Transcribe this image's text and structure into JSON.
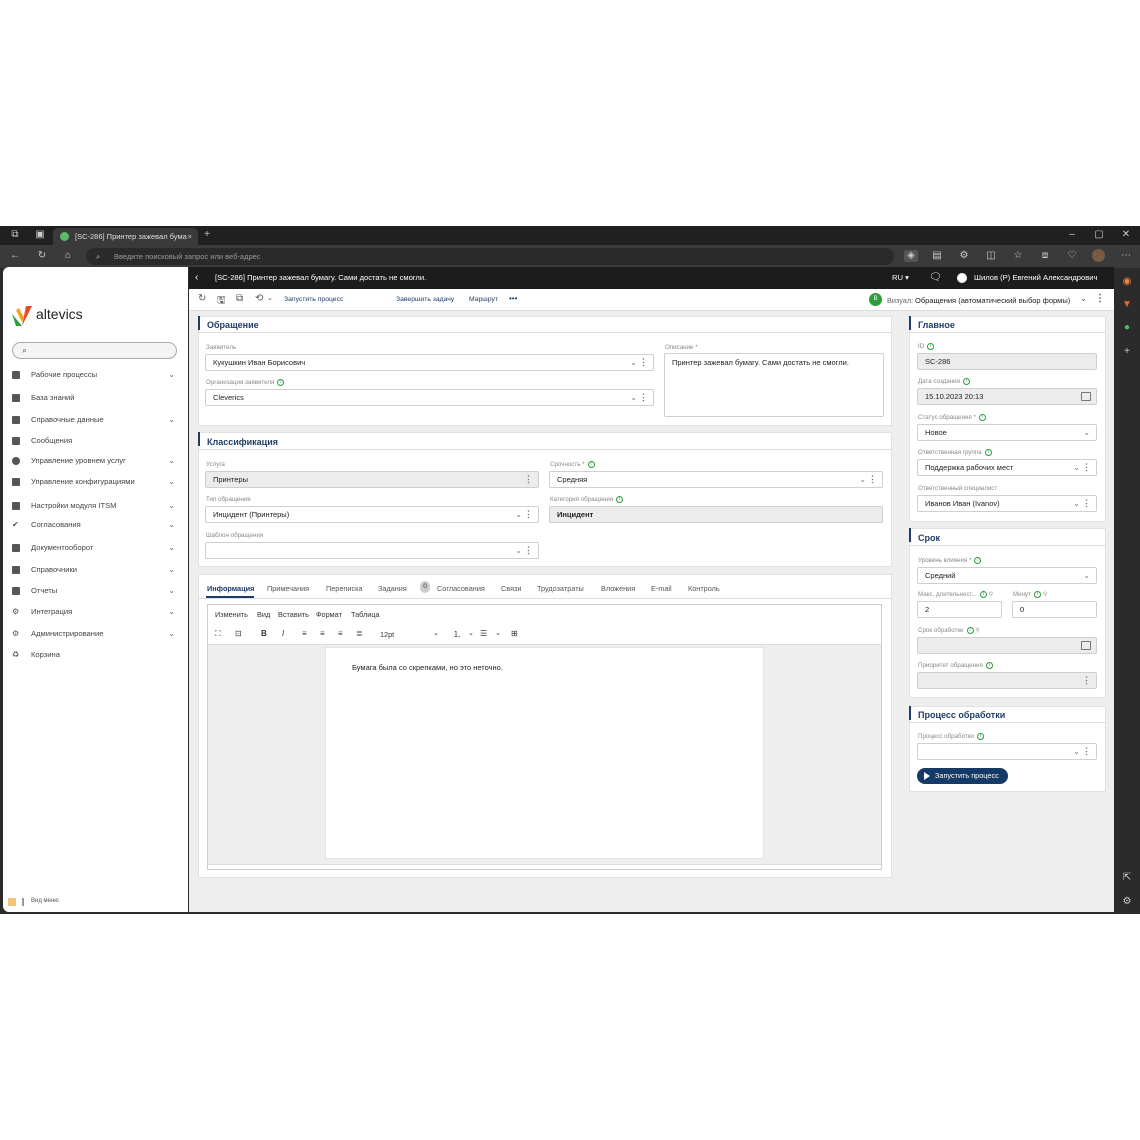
{
  "browser": {
    "tab_title": "[SC-286] Принтер зажевал бума",
    "tab_close": "×",
    "new_tab": "+",
    "address_placeholder": "Введите поисковый запрос или веб-адрес",
    "window_controls": [
      "–",
      "▢",
      "✕"
    ]
  },
  "sidebar": {
    "brand": "altevics",
    "items": [
      {
        "label": "Рабочие процессы",
        "chevron": "⌄"
      },
      {
        "label": "База знаний",
        "chevron": ""
      },
      {
        "label": "Справочные данные",
        "chevron": "⌄"
      },
      {
        "label": "Сообщения",
        "chevron": ""
      },
      {
        "label": "Управление уровнем услуг",
        "chevron": "⌄"
      },
      {
        "label": "Управление конфигурациями",
        "chevron": "⌄"
      },
      {
        "label": "Настройки модуля ITSM",
        "chevron": "⌄"
      },
      {
        "label": "Согласования",
        "chevron": "⌄"
      },
      {
        "label": "Документооборот",
        "chevron": "⌄"
      },
      {
        "label": "Справочники",
        "chevron": "⌄"
      },
      {
        "label": "Отчеты",
        "chevron": "⌄"
      },
      {
        "label": "Интеграция",
        "chevron": "⌄"
      },
      {
        "label": "Администрирование",
        "chevron": "⌄"
      },
      {
        "label": "Корзина",
        "chevron": ""
      }
    ],
    "footer_label": "Вид меню"
  },
  "header": {
    "back": "‹",
    "title": "[SC-286] Принтер зажевал бумагу. Сами достать не смогли.",
    "lang": "RU ▾",
    "user": "Шилов (Р) Евгений Александрович"
  },
  "toolbar": {
    "start_process": "Запустить процесс",
    "finish_task": "Завершить задачу",
    "route": "Маршрут",
    "more": "•••",
    "visual_label": "Визуал:",
    "visual_value": "Обращения (автоматический выбор формы)",
    "visual_badge": "В"
  },
  "request": {
    "title": "Обращение",
    "applicant_label": "Заявитель",
    "applicant": "Кукушкин Иван Борисович",
    "org_label": "Организация заявителя",
    "org": "Cleverics",
    "desc_label": "Описание *",
    "desc": "Принтер зажевал бумагу. Сами достать не смогли."
  },
  "classification": {
    "title": "Классификация",
    "service_label": "Услуга",
    "service": "Принтеры",
    "urgency_label": "Срочность *",
    "urgency": "Средняя",
    "type_label": "Тип обращения",
    "type": "Инцидент (Принтеры)",
    "category_label": "Категория обращения",
    "category": "Инцидент",
    "template_label": "Шаблон обращения",
    "template": ""
  },
  "tabs": {
    "items": [
      "Информация",
      "Примечания",
      "Переписка",
      "Задания",
      "Согласования",
      "Связи",
      "Трудозатраты",
      "Вложения",
      "E-mail",
      "Контроль"
    ],
    "tasks_count": "0"
  },
  "editor": {
    "menu": [
      "Изменить",
      "Вид",
      "Вставить",
      "Формат",
      "Таблица"
    ],
    "font_size": "12pt",
    "content": "Бумага была со скрепками, но это неточно."
  },
  "main_panel": {
    "title": "Главное",
    "id_label": "ID",
    "id": "SC-286",
    "created_label": "Дата создания",
    "created": "15.10.2023 20:13",
    "status_label": "Статус обращения *",
    "status": "Новое",
    "group_label": "Ответственная группа",
    "group": "Поддержка рабочих мест",
    "specialist_label": "Ответственный специалист",
    "specialist": "Иванов Иван (Ivanov)"
  },
  "deadline": {
    "title": "Срок",
    "impact_label": "Уровень влияния *",
    "impact": "Средний",
    "max_dur_label": "Макс. длительност...",
    "max_dur": "2",
    "minutes_label": "Минут",
    "minutes": "0",
    "due_label": "Срок обработки",
    "due": "",
    "priority_label": "Приоритет обращения",
    "priority": ""
  },
  "process": {
    "title": "Процесс обработки",
    "field_label": "Процесс обработки",
    "field": "",
    "run_button": "Запустить процесс"
  },
  "colors": {
    "accent": "#1d3d66",
    "info_green": "#2e9d3a",
    "dark_bar": "#1c1c1c"
  }
}
